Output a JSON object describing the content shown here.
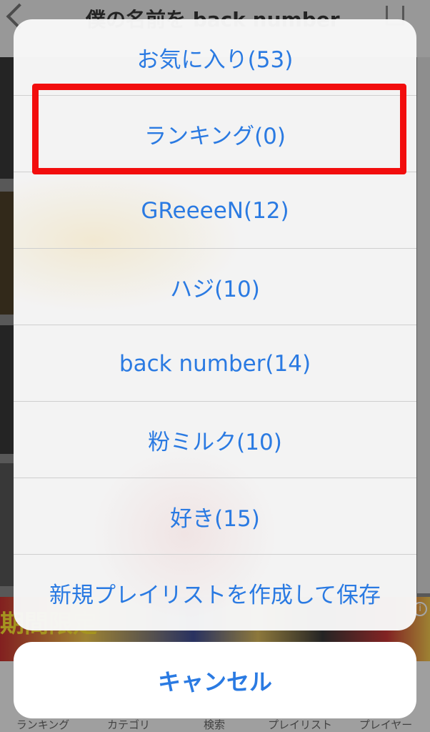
{
  "background_app": {
    "nav_title": "僕の名前を back number",
    "tabs": [
      "ランキング",
      "カテゴリ",
      "検索",
      "プレイリスト",
      "プレイヤー"
    ],
    "ad_text": "期間限定"
  },
  "action_sheet": {
    "items": [
      "お気に入り(53)",
      "ランキング(0)",
      "GReeeeN(12)",
      "ハジ(10)",
      "back number(14)",
      "粉ミルク(10)",
      "好き(15)",
      "新規プレイリストを作成して保存"
    ],
    "highlighted_index": 1,
    "cancel_label": "キャンセル"
  },
  "colors": {
    "action_text": "#2a7ae2",
    "highlight_border": "#f20d0d",
    "sheet_bg": "#f8f8f8"
  }
}
